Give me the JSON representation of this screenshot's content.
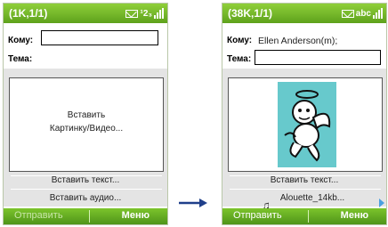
{
  "left": {
    "title": "(1K,1/1)",
    "mode": "¹2₃",
    "to_label": "Кому:",
    "subject_label": "Тема:",
    "media_line1": "Вставить",
    "media_line2": "Картинку/Видео...",
    "insert_text": "Вставить текст...",
    "insert_audio": "Вставить аудио...",
    "soft_left": "Отправить",
    "soft_right": "Меню"
  },
  "right": {
    "title": "(38K,1/1)",
    "mode": "abc",
    "to_label": "Кому:",
    "to_value": "Ellen Anderson(m);",
    "subject_label": "Тема:",
    "insert_text": "Вставить текст...",
    "audio_name": "Alouette_14kb...",
    "soft_left": "Отправить",
    "soft_right": "Меню"
  },
  "colors": {
    "accent": "#6db52a",
    "photo_bg": "#67c9cc",
    "arrow": "#1f3f8a"
  },
  "icons": [
    "envelope-icon",
    "signal-icon",
    "music-note-icon",
    "arrow-right-icon",
    "scroll-right-icon"
  ]
}
